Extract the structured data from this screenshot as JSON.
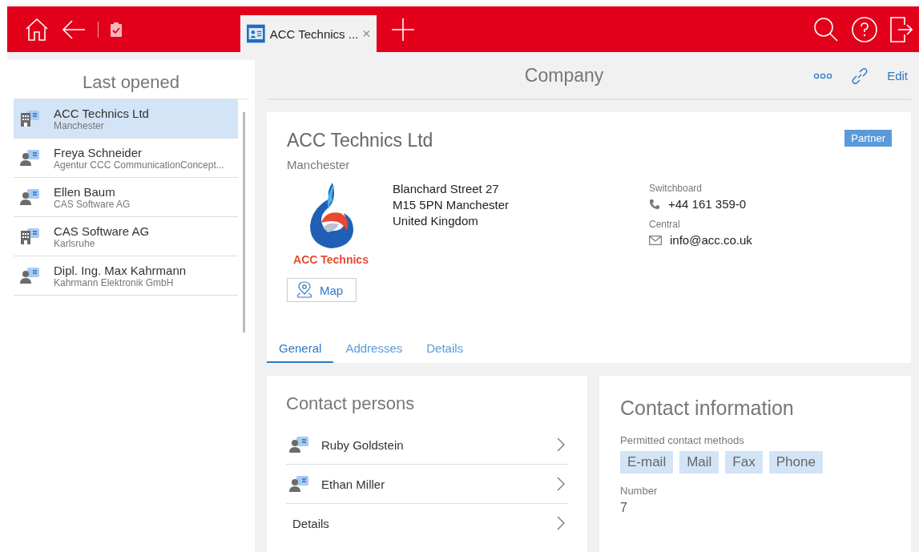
{
  "top_bar": {
    "tabs": [
      {
        "label": "ACC Technics ...",
        "selected": true
      }
    ]
  },
  "sidebar": {
    "title": "Last opened",
    "items": [
      {
        "kind": "company",
        "title": "ACC Technics Ltd",
        "subtitle": "Manchester",
        "selected": true
      },
      {
        "kind": "person",
        "title": "Freya Schneider",
        "subtitle": "Agentur CCC CommunicationConcept...",
        "selected": false
      },
      {
        "kind": "person",
        "title": "Ellen Baum",
        "subtitle": "CAS Software AG",
        "selected": false
      },
      {
        "kind": "company",
        "title": "CAS Software AG",
        "subtitle": "Karlsruhe",
        "selected": false
      },
      {
        "kind": "person",
        "title": "Dipl. Ing. Max Kahrmann",
        "subtitle": "Kahrmann Elektronik GmbH",
        "selected": false
      }
    ]
  },
  "header": {
    "title": "Company",
    "actions": [
      {
        "kind": "more"
      },
      {
        "kind": "link"
      },
      {
        "kind": "text",
        "label": "Edit"
      }
    ]
  },
  "company": {
    "name": "ACC Technics Ltd",
    "city": "Manchester",
    "badge": "Partner",
    "logo_text": "ACC Technics",
    "address": [
      "Blanchard Street 27",
      "M15 5PN Manchester",
      "United Kingdom"
    ],
    "map_button": "Map",
    "contacts": [
      {
        "kind": "phone",
        "label": "Switchboard",
        "value": "+44 161 359-0"
      },
      {
        "kind": "email",
        "label": "Central",
        "value": "info@acc.co.uk"
      }
    ],
    "tabs": [
      {
        "label": "General",
        "selected": true
      },
      {
        "label": "Addresses",
        "selected": false
      },
      {
        "label": "Details",
        "selected": false
      }
    ]
  },
  "contact_persons": {
    "title": "Contact persons",
    "items": [
      {
        "kind": "person",
        "label": "Ruby Goldstein"
      },
      {
        "kind": "person",
        "label": "Ethan Miller"
      },
      {
        "kind": "link",
        "label": "Details"
      }
    ]
  },
  "contact_information": {
    "title": "Contact information",
    "methods_label": "Permitted contact methods",
    "methods": [
      "E-mail",
      "Mail",
      "Fax",
      "Phone"
    ],
    "number_label": "Number",
    "number": "7"
  }
}
